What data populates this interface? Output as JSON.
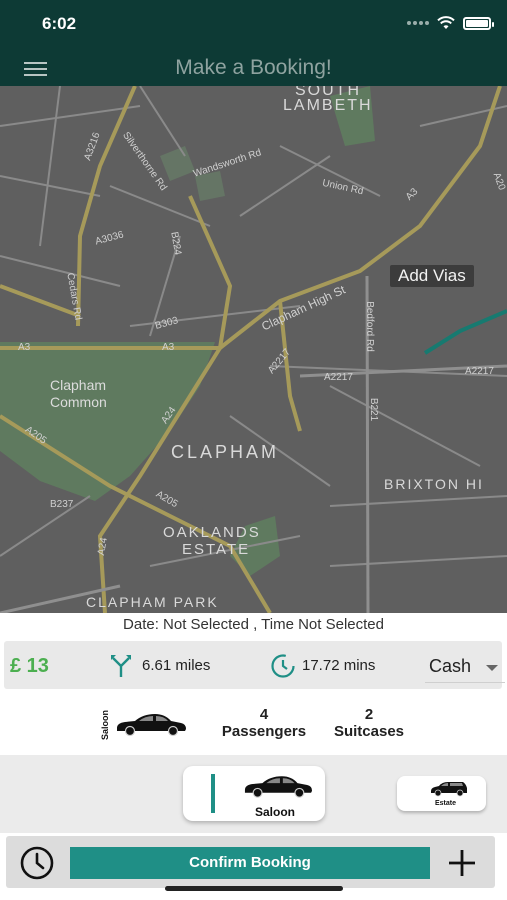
{
  "status_bar": {
    "time": "6:02"
  },
  "header": {
    "title": "Make a Booking!",
    "menu_icon": "hamburger-menu-icon"
  },
  "map": {
    "add_vias_label": "Add Vias",
    "area_labels": [
      "SOUTH",
      "LAMBETH",
      "Clapham",
      "Common",
      "CLAPHAM",
      "BRIXTON HI",
      "OAKLANDS",
      "ESTATE",
      "CLAPHAM PARK"
    ],
    "road_labels": [
      "A3216",
      "Wandsworth Rd",
      "Silverthorne Rd",
      "Union Rd",
      "A3",
      "A20",
      "A3036",
      "B224",
      "Cedars Rd",
      "Clapham High St",
      "Bedford Rd",
      "B303",
      "A3",
      "A3",
      "A2217",
      "A2217",
      "A2217",
      "A24",
      "A205",
      "B221",
      "B237",
      "A205",
      "A24"
    ]
  },
  "booking": {
    "date_line": "Date: Not Selected , Time  Not Selected",
    "price": "£ 13",
    "distance": "6.61 miles",
    "duration": "17.72 mins",
    "payment_method": "Cash"
  },
  "vehicle_summary": {
    "vehicle_type": "Saloon",
    "passengers_count": "4",
    "passengers_label": "Passengers",
    "suitcases_count": "2",
    "suitcases_label": "Suitcases"
  },
  "vehicle_options": [
    {
      "label": "Saloon",
      "selected": true
    },
    {
      "label": "Estate",
      "selected": false
    }
  ],
  "footer": {
    "confirm_label": "Confirm Booking",
    "clock_icon": "clock-icon",
    "add_icon": "plus-icon"
  },
  "colors": {
    "header_bg": "#0d3a35",
    "accent": "#1f8f86",
    "price_green": "#4caf50",
    "map_bg": "#5f5f5f"
  }
}
